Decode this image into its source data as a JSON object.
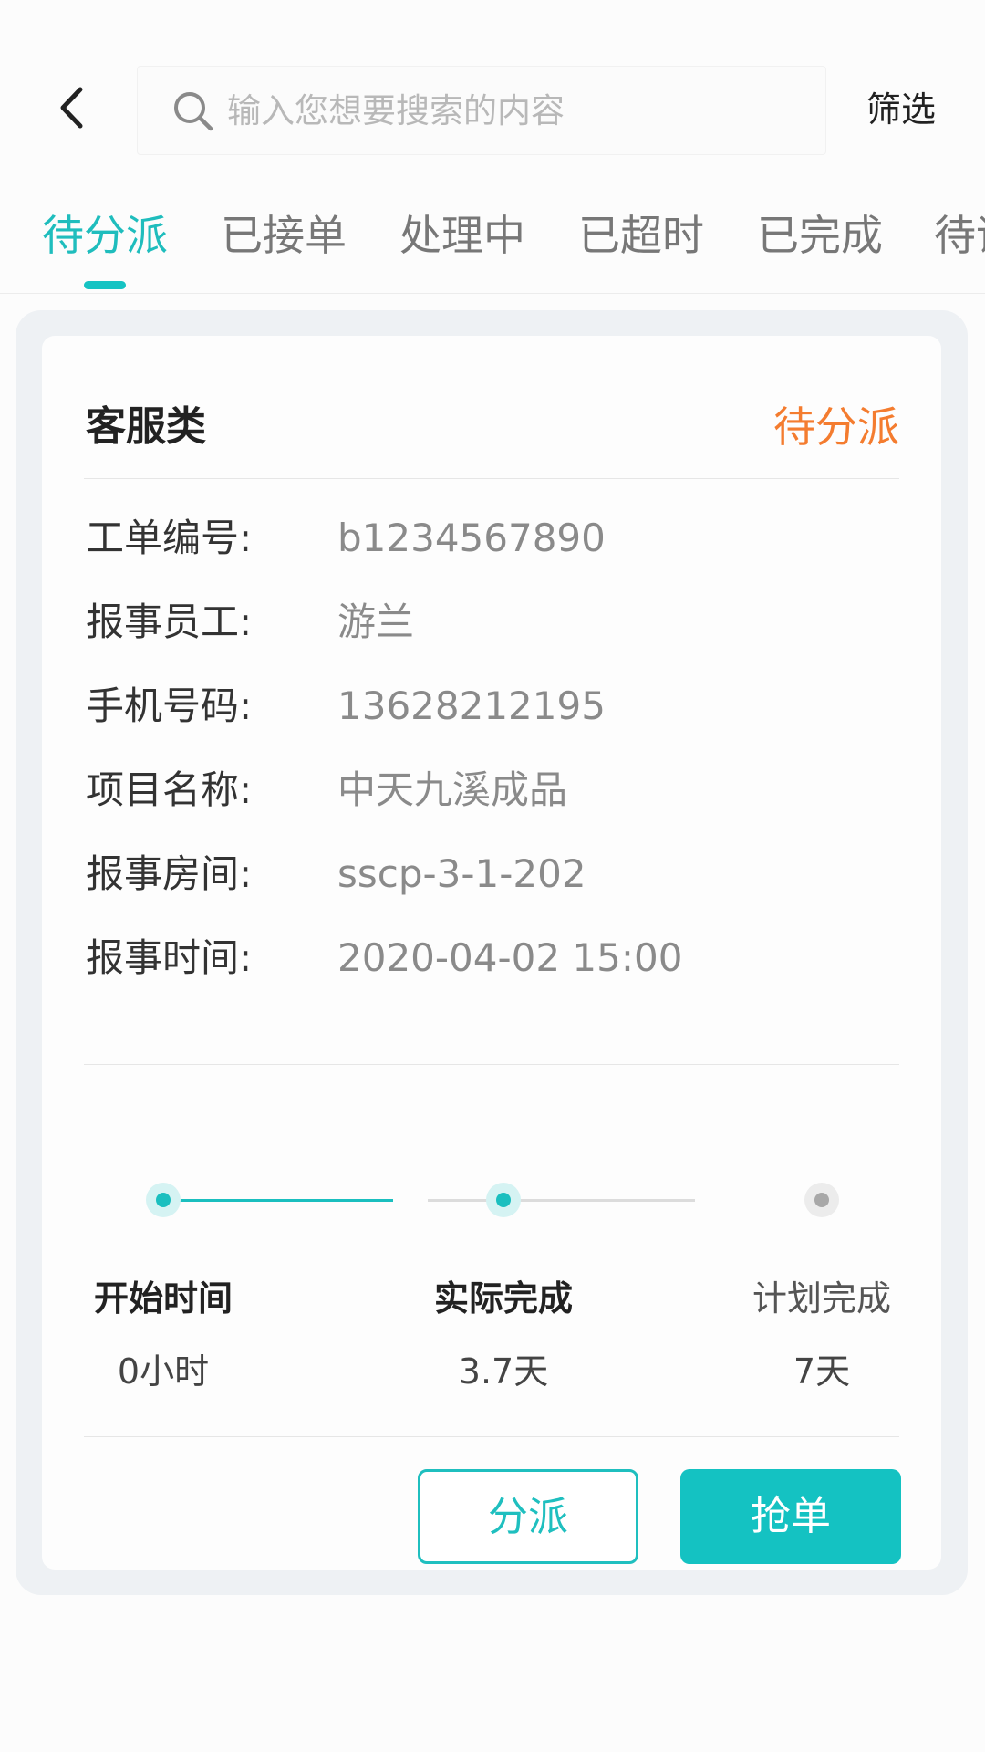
{
  "header": {
    "search_placeholder": "输入您想要搜索的内容",
    "filter_label": "筛选"
  },
  "tabs": [
    {
      "label": "待分派",
      "active": true
    },
    {
      "label": "已接单",
      "active": false
    },
    {
      "label": "处理中",
      "active": false
    },
    {
      "label": "已超时",
      "active": false
    },
    {
      "label": "已完成",
      "active": false
    },
    {
      "label": "待评价",
      "active": false
    }
  ],
  "card": {
    "category": "客服类",
    "status": "待分派",
    "fields": [
      {
        "label": "工单编号:",
        "value": "b1234567890"
      },
      {
        "label": "报事员工:",
        "value": "游兰"
      },
      {
        "label": "手机号码:",
        "value": "13628212195"
      },
      {
        "label": "项目名称:",
        "value": "中天九溪成品"
      },
      {
        "label": "报事房间:",
        "value": "sscp-3-1-202"
      },
      {
        "label": "报事时间:",
        "value": "2020-04-02 15:00"
      }
    ],
    "timeline": [
      {
        "label": "开始时间",
        "value": "0小时",
        "reached": true
      },
      {
        "label": "实际完成",
        "value": "3.7天",
        "reached": true
      },
      {
        "label": "计划完成",
        "value": "7天",
        "reached": false
      }
    ],
    "buttons": {
      "assign": "分派",
      "grab": "抢单"
    }
  },
  "colors": {
    "accent": "#14c2c2",
    "status_orange": "#f47c2f",
    "card_outer_bg": "#eef1f4"
  },
  "icons": {
    "back": "chevron-left-icon",
    "search": "search-icon"
  }
}
